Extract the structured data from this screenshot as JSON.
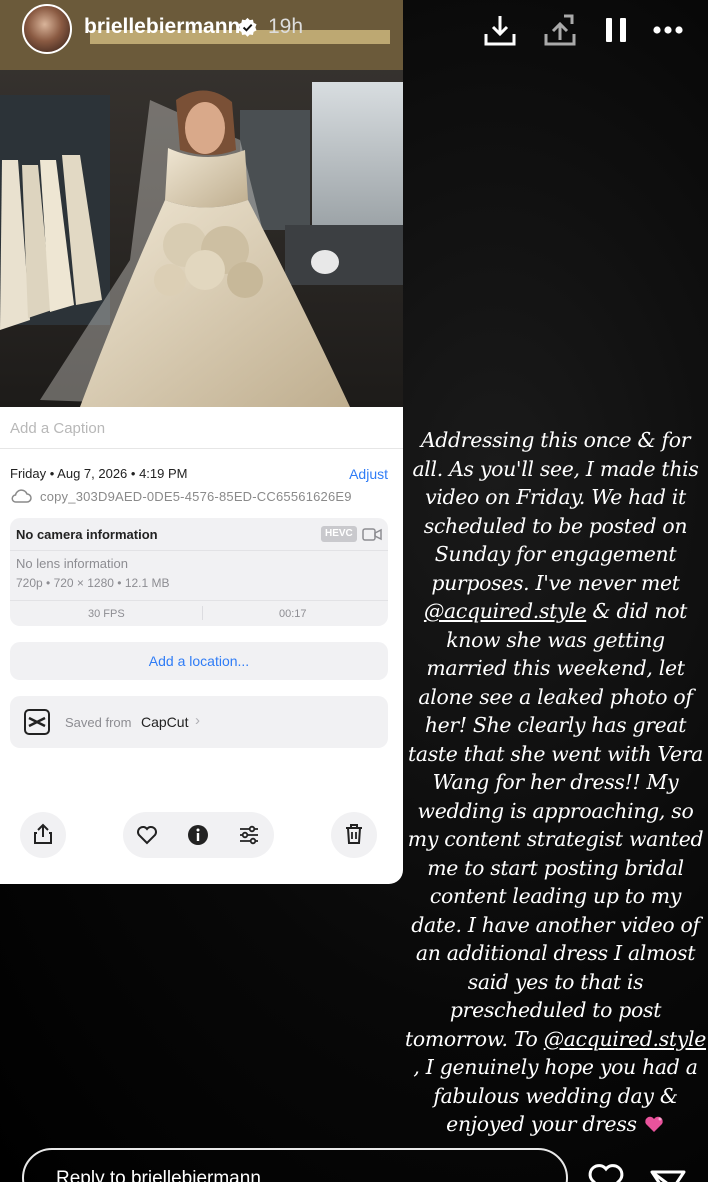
{
  "header": {
    "username": "briellebiermann",
    "time_ago": "19h",
    "icons": [
      "download-icon",
      "add-to-story-icon",
      "pause-icon",
      "more-icon"
    ]
  },
  "photos_info": {
    "caption_placeholder": "Add a Caption",
    "date_time": "Friday • Aug 7, 2026 • 4:19 PM",
    "adjust_label": "Adjust",
    "file_name": "copy_303D9AED-0DE5-4576-85ED-CC65561626E9",
    "camera_info": "No camera information",
    "format_badge": "HEVC",
    "lens_info": "No lens information",
    "specs": "720p • 720 × 1280 • 12.1 MB",
    "fps": "30 FPS",
    "duration": "00:17",
    "add_location_label": "Add a location...",
    "saved_from_label": "Saved from",
    "saved_from_app": "CapCut",
    "toolbar_icons": [
      "share-icon",
      "heart-icon",
      "info-icon",
      "adjustments-icon",
      "trash-icon"
    ]
  },
  "story_text": {
    "part1": "Addressing this once & for all. As you'll see, I made this video on Friday. We had it scheduled to be posted on Sunday for engagement purposes. I've never met ",
    "mention1": "@acquired.style",
    "part2": " & did not know she was getting married this weekend, let alone see a leaked photo of her! She clearly has great taste that she went with Vera Wang for her dress!! My wedding is approaching, so my content strategist wanted me to start posting bridal content leading up to my date. I have another video of an additional dress I almost said yes to that is prescheduled to post tomorrow. To ",
    "mention2": "@acquired.style",
    "part3": " , I genuinely hope you had a fabulous wedding day & enjoyed your dress "
  },
  "reply": {
    "placeholder": "Reply to briellebiermann"
  },
  "colors": {
    "accent_blue": "#2f7cf6",
    "panel_gray": "#f1f1f3",
    "story_bg": "#000000"
  }
}
